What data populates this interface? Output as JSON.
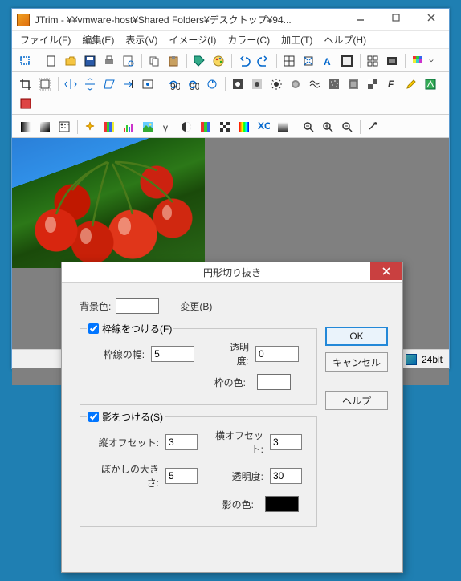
{
  "window": {
    "title": "JTrim - ¥¥vmware-host¥Shared Folders¥デスクトップ¥94..."
  },
  "menu": {
    "file": "ファイル(F)",
    "edit": "編集(E)",
    "view": "表示(V)",
    "image": "イメージ(I)",
    "color": "カラー(C)",
    "process": "加工(T)",
    "help": "ヘルプ(H)"
  },
  "status": {
    "bit": "24bit"
  },
  "dialog": {
    "title": "円形切り抜き",
    "bg_label": "背景色:",
    "change_btn": "変更(B)",
    "ok": "OK",
    "cancel": "キャンセル",
    "help": "ヘルプ",
    "frame": {
      "label": "枠線をつける(F)",
      "width_label": "枠線の幅:",
      "width_value": "5",
      "opacity_label": "透明度:",
      "opacity_value": "0",
      "color_label": "枠の色:"
    },
    "shadow": {
      "label": "影をつける(S)",
      "voffset_label": "縦オフセット:",
      "voffset_value": "3",
      "hoffset_label": "横オフセット:",
      "hoffset_value": "3",
      "blur_label": "ぼかしの大きさ:",
      "blur_value": "5",
      "opacity_label": "透明度:",
      "opacity_value": "30",
      "color_label": "影の色:"
    }
  }
}
